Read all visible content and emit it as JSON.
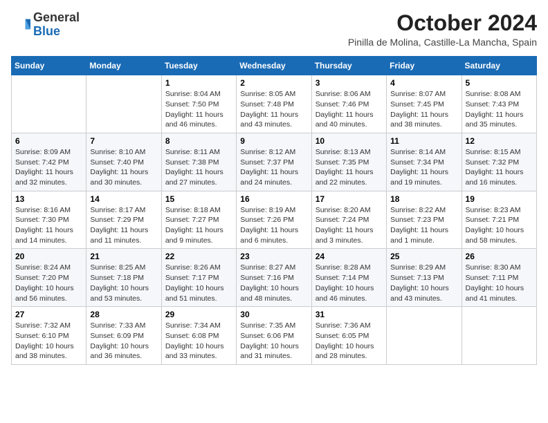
{
  "logo": {
    "general": "General",
    "blue": "Blue"
  },
  "header": {
    "month": "October 2024",
    "location": "Pinilla de Molina, Castille-La Mancha, Spain"
  },
  "weekdays": [
    "Sunday",
    "Monday",
    "Tuesday",
    "Wednesday",
    "Thursday",
    "Friday",
    "Saturday"
  ],
  "weeks": [
    [
      {
        "day": "",
        "info": ""
      },
      {
        "day": "",
        "info": ""
      },
      {
        "day": "1",
        "info": "Sunrise: 8:04 AM\nSunset: 7:50 PM\nDaylight: 11 hours and 46 minutes."
      },
      {
        "day": "2",
        "info": "Sunrise: 8:05 AM\nSunset: 7:48 PM\nDaylight: 11 hours and 43 minutes."
      },
      {
        "day": "3",
        "info": "Sunrise: 8:06 AM\nSunset: 7:46 PM\nDaylight: 11 hours and 40 minutes."
      },
      {
        "day": "4",
        "info": "Sunrise: 8:07 AM\nSunset: 7:45 PM\nDaylight: 11 hours and 38 minutes."
      },
      {
        "day": "5",
        "info": "Sunrise: 8:08 AM\nSunset: 7:43 PM\nDaylight: 11 hours and 35 minutes."
      }
    ],
    [
      {
        "day": "6",
        "info": "Sunrise: 8:09 AM\nSunset: 7:42 PM\nDaylight: 11 hours and 32 minutes."
      },
      {
        "day": "7",
        "info": "Sunrise: 8:10 AM\nSunset: 7:40 PM\nDaylight: 11 hours and 30 minutes."
      },
      {
        "day": "8",
        "info": "Sunrise: 8:11 AM\nSunset: 7:38 PM\nDaylight: 11 hours and 27 minutes."
      },
      {
        "day": "9",
        "info": "Sunrise: 8:12 AM\nSunset: 7:37 PM\nDaylight: 11 hours and 24 minutes."
      },
      {
        "day": "10",
        "info": "Sunrise: 8:13 AM\nSunset: 7:35 PM\nDaylight: 11 hours and 22 minutes."
      },
      {
        "day": "11",
        "info": "Sunrise: 8:14 AM\nSunset: 7:34 PM\nDaylight: 11 hours and 19 minutes."
      },
      {
        "day": "12",
        "info": "Sunrise: 8:15 AM\nSunset: 7:32 PM\nDaylight: 11 hours and 16 minutes."
      }
    ],
    [
      {
        "day": "13",
        "info": "Sunrise: 8:16 AM\nSunset: 7:30 PM\nDaylight: 11 hours and 14 minutes."
      },
      {
        "day": "14",
        "info": "Sunrise: 8:17 AM\nSunset: 7:29 PM\nDaylight: 11 hours and 11 minutes."
      },
      {
        "day": "15",
        "info": "Sunrise: 8:18 AM\nSunset: 7:27 PM\nDaylight: 11 hours and 9 minutes."
      },
      {
        "day": "16",
        "info": "Sunrise: 8:19 AM\nSunset: 7:26 PM\nDaylight: 11 hours and 6 minutes."
      },
      {
        "day": "17",
        "info": "Sunrise: 8:20 AM\nSunset: 7:24 PM\nDaylight: 11 hours and 3 minutes."
      },
      {
        "day": "18",
        "info": "Sunrise: 8:22 AM\nSunset: 7:23 PM\nDaylight: 11 hours and 1 minute."
      },
      {
        "day": "19",
        "info": "Sunrise: 8:23 AM\nSunset: 7:21 PM\nDaylight: 10 hours and 58 minutes."
      }
    ],
    [
      {
        "day": "20",
        "info": "Sunrise: 8:24 AM\nSunset: 7:20 PM\nDaylight: 10 hours and 56 minutes."
      },
      {
        "day": "21",
        "info": "Sunrise: 8:25 AM\nSunset: 7:18 PM\nDaylight: 10 hours and 53 minutes."
      },
      {
        "day": "22",
        "info": "Sunrise: 8:26 AM\nSunset: 7:17 PM\nDaylight: 10 hours and 51 minutes."
      },
      {
        "day": "23",
        "info": "Sunrise: 8:27 AM\nSunset: 7:16 PM\nDaylight: 10 hours and 48 minutes."
      },
      {
        "day": "24",
        "info": "Sunrise: 8:28 AM\nSunset: 7:14 PM\nDaylight: 10 hours and 46 minutes."
      },
      {
        "day": "25",
        "info": "Sunrise: 8:29 AM\nSunset: 7:13 PM\nDaylight: 10 hours and 43 minutes."
      },
      {
        "day": "26",
        "info": "Sunrise: 8:30 AM\nSunset: 7:11 PM\nDaylight: 10 hours and 41 minutes."
      }
    ],
    [
      {
        "day": "27",
        "info": "Sunrise: 7:32 AM\nSunset: 6:10 PM\nDaylight: 10 hours and 38 minutes."
      },
      {
        "day": "28",
        "info": "Sunrise: 7:33 AM\nSunset: 6:09 PM\nDaylight: 10 hours and 36 minutes."
      },
      {
        "day": "29",
        "info": "Sunrise: 7:34 AM\nSunset: 6:08 PM\nDaylight: 10 hours and 33 minutes."
      },
      {
        "day": "30",
        "info": "Sunrise: 7:35 AM\nSunset: 6:06 PM\nDaylight: 10 hours and 31 minutes."
      },
      {
        "day": "31",
        "info": "Sunrise: 7:36 AM\nSunset: 6:05 PM\nDaylight: 10 hours and 28 minutes."
      },
      {
        "day": "",
        "info": ""
      },
      {
        "day": "",
        "info": ""
      }
    ]
  ]
}
